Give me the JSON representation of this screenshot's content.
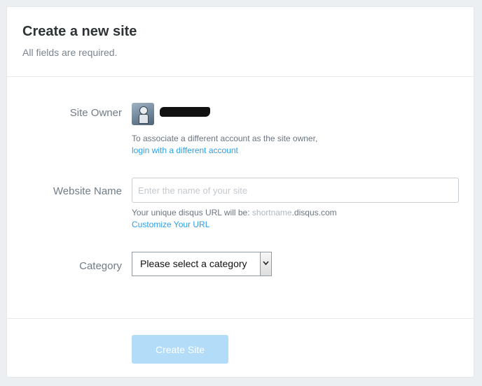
{
  "header": {
    "title": "Create a new site",
    "subtitle": "All fields are required."
  },
  "site_owner": {
    "label": "Site Owner",
    "help_text": "To associate a different account as the site owner,",
    "link_label": "login with a different account"
  },
  "website_name": {
    "label": "Website Name",
    "placeholder": "Enter the name of your site",
    "value": "",
    "url_help_prefix": "Your unique disqus URL will be: ",
    "url_shortname": "shortname",
    "url_suffix": ".disqus.com",
    "customize_link_label": "Customize Your URL"
  },
  "category": {
    "label": "Category",
    "selected": "Please select a category"
  },
  "footer": {
    "create_button_label": "Create Site"
  },
  "colors": {
    "link": "#2e9fe6",
    "button_disabled": "#b3dcf9"
  }
}
